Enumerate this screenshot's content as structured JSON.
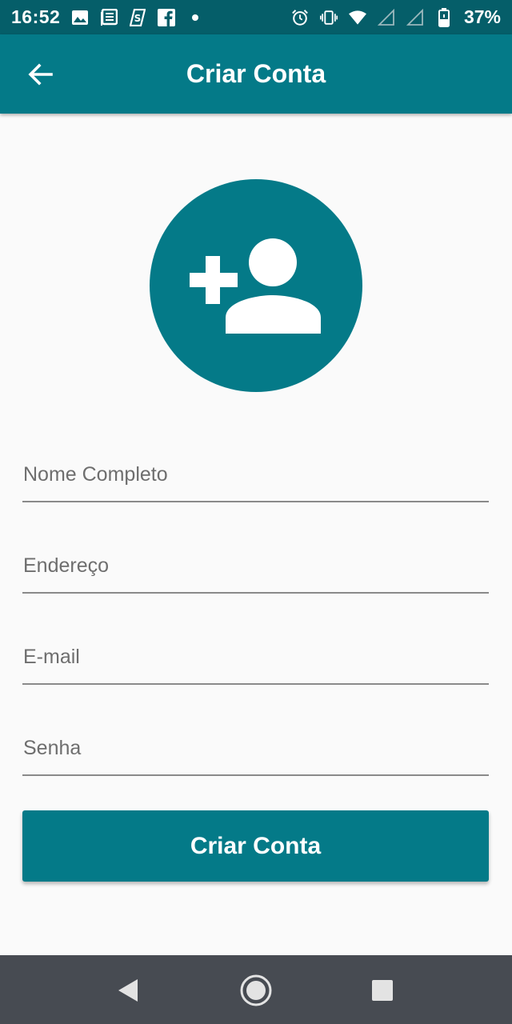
{
  "status_bar": {
    "time": "16:52",
    "battery": "37%",
    "left_icons": [
      "image-icon",
      "news-icon",
      "app-s-icon",
      "facebook-icon",
      "dot-icon"
    ],
    "right_icons": [
      "alarm-icon",
      "vibrate-icon",
      "wifi-icon",
      "signal-icon",
      "signal-icon",
      "battery-icon"
    ]
  },
  "app_bar": {
    "title": "Criar Conta",
    "back_icon": "arrow-back-icon"
  },
  "avatar": {
    "icon": "person-add-icon"
  },
  "form": {
    "nome_placeholder": "Nome Completo",
    "endereco_placeholder": "Endereço",
    "email_placeholder": "E-mail",
    "senha_placeholder": "Senha",
    "submit_label": "Criar Conta"
  },
  "nav_bar": {
    "back_icon": "triangle-back-icon",
    "home_icon": "circle-home-icon",
    "recent_icon": "square-recent-icon"
  },
  "colors": {
    "primary": "#047a88",
    "status_bar": "#055e69",
    "background": "#fafafa",
    "nav_bar": "#474b52"
  }
}
